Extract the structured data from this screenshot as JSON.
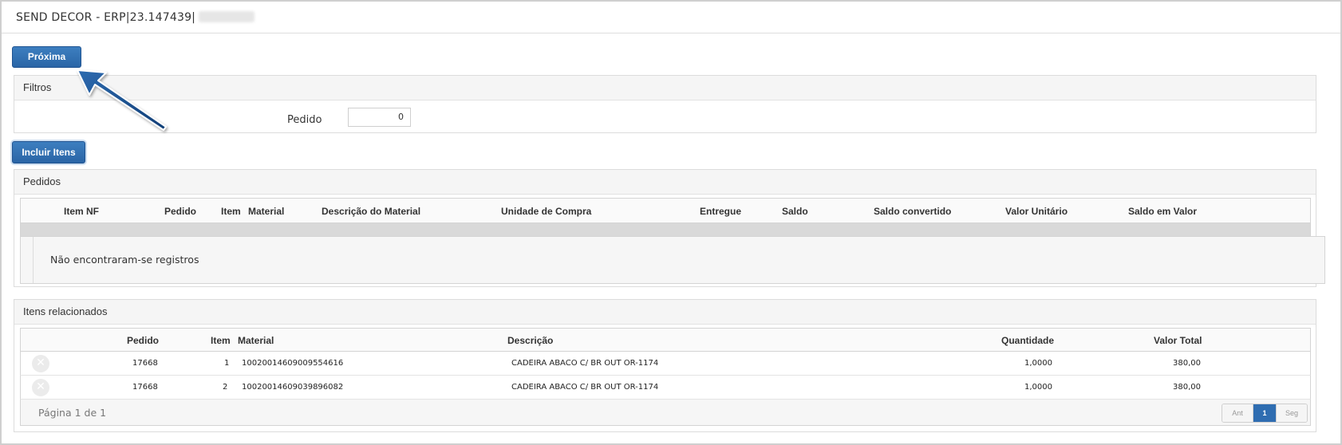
{
  "window": {
    "title": "SEND DECOR - ERP|23.147439|"
  },
  "toolbar": {
    "next_label": "Próxima",
    "include_items_label": "Incluir Itens"
  },
  "filters": {
    "title": "Filtros",
    "order_label": "Pedido",
    "order_value": "0"
  },
  "orders": {
    "title": "Pedidos",
    "columns": [
      "Item NF",
      "Pedido",
      "Item",
      "Material",
      "Descrição do Material",
      "Unidade de Compra",
      "Entregue",
      "Saldo",
      "Saldo convertido",
      "Valor Unitário",
      "Saldo em Valor"
    ],
    "empty_message": "Não encontraram-se registros"
  },
  "related": {
    "title": "Itens relacionados",
    "columns": [
      "Pedido",
      "Item",
      "Material",
      "Descrição",
      "Quantidade",
      "Valor Total"
    ],
    "rows": [
      {
        "pedido": "17668",
        "item": "1",
        "material": "10020014609009554616",
        "descricao": "CADEIRA ABACO C/ BR OUT OR-1174",
        "quantidade": "1,0000",
        "valor_total": "380,00"
      },
      {
        "pedido": "17668",
        "item": "2",
        "material": "10020014609039896082",
        "descricao": "CADEIRA ABACO C/ BR OUT OR-1174",
        "quantidade": "1,0000",
        "valor_total": "380,00"
      }
    ],
    "pagination": {
      "text": "Página 1 de 1",
      "prev": "Ant",
      "current": "1",
      "next": "Seg"
    }
  },
  "icons": {
    "delete": "close-circle-icon",
    "annotation": "arrow-pointer-icon"
  },
  "colors": {
    "primary_button": "#2f6db1",
    "arrow": "#0f3d75"
  }
}
